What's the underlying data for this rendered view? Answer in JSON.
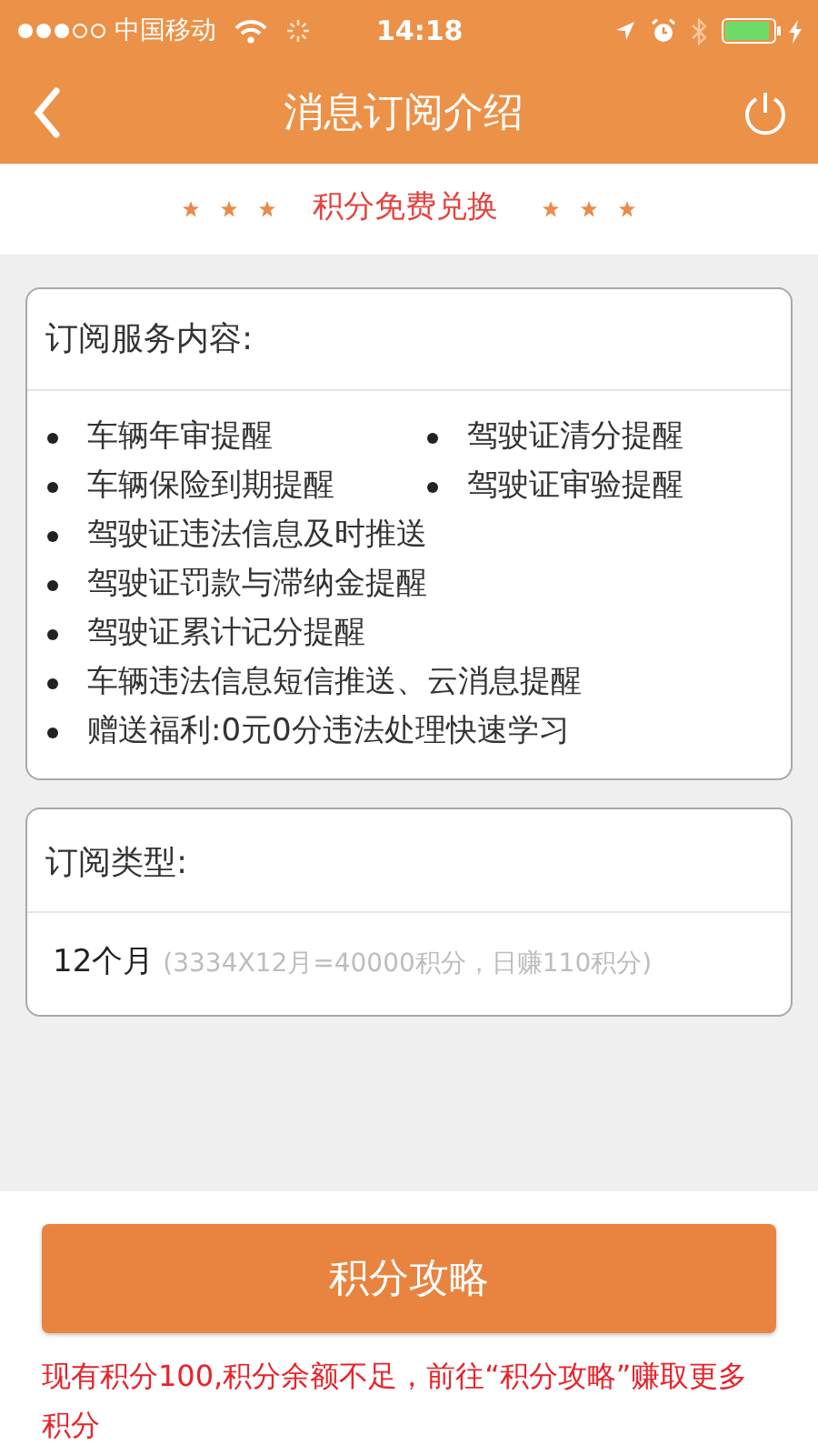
{
  "status_bar": {
    "carrier": "中国移动",
    "time": "14:18"
  },
  "nav": {
    "title": "消息订阅介绍"
  },
  "banner": {
    "text": "积分免费兑换"
  },
  "service_card": {
    "title": "订阅服务内容:",
    "rows": [
      [
        "车辆年审提醒",
        "驾驶证清分提醒"
      ],
      [
        "车辆保险到期提醒",
        "驾驶证审验提醒"
      ],
      [
        "驾驶证违法信息及时推送"
      ],
      [
        "驾驶证罚款与滞纳金提醒"
      ],
      [
        "驾驶证累计记分提醒"
      ],
      [
        "车辆违法信息短信推送、云消息提醒"
      ],
      [
        "赠送福利:0元0分违法处理快速学习"
      ]
    ]
  },
  "type_card": {
    "title": "订阅类型:",
    "value": "12个月",
    "note": "(3334X12月=40000积分，日赚110积分)"
  },
  "action_button": {
    "label": "积分攻略"
  },
  "warning": "现有积分100,积分余额不足，前往“积分攻略”赚取更多积分"
}
